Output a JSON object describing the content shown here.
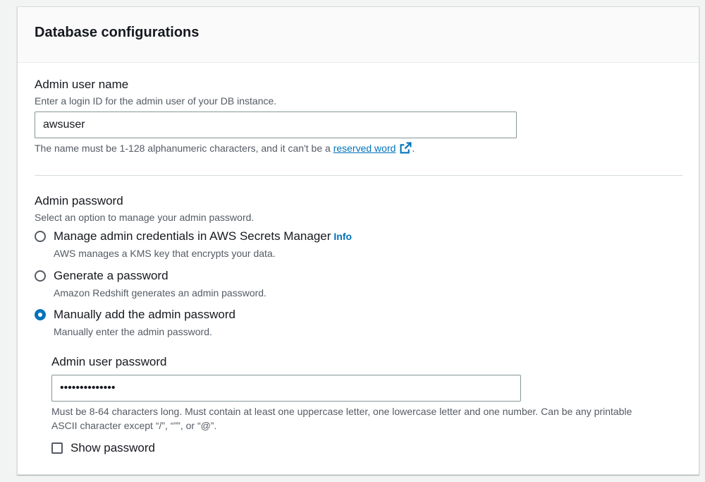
{
  "panel": {
    "title": "Database configurations"
  },
  "admin_user": {
    "label": "Admin user name",
    "description": "Enter a login ID for the admin user of your DB instance.",
    "value": "awsuser",
    "hint_prefix": "The name must be 1-128 alphanumeric characters, and it can't be a ",
    "hint_link": "reserved word",
    "hint_suffix": "."
  },
  "admin_password": {
    "label": "Admin password",
    "description": "Select an option to manage your admin password.",
    "options": [
      {
        "label": "Manage admin credentials in AWS Secrets Manager",
        "info": "Info",
        "description": "AWS manages a KMS key that encrypts your data.",
        "checked": false
      },
      {
        "label": "Generate a password",
        "description": "Amazon Redshift generates an admin password.",
        "checked": false
      },
      {
        "label": "Manually add the admin password",
        "description": "Manually enter the admin password.",
        "checked": true
      }
    ]
  },
  "user_password": {
    "label": "Admin user password",
    "value": "••••••••••••••",
    "hint_line1": "Must be 8-64 characters long. Must contain at least one uppercase letter, one lowercase letter and one number. Can be any printable",
    "hint_line2": "ASCII character except “/”, “””, or “@”.",
    "show_password_label": "Show password",
    "show_password_checked": false
  },
  "colors": {
    "accent": "#0073bb",
    "text": "#16191f",
    "muted": "#545b64",
    "border": "#879596",
    "background": "#f2f3f3"
  },
  "icons": {
    "external_link": "external-link-icon"
  }
}
